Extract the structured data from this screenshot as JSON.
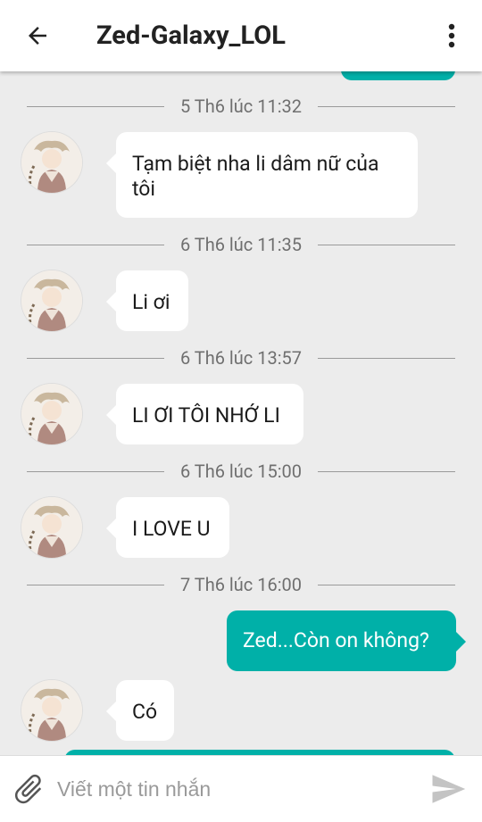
{
  "header": {
    "title": "Zed-Galaxy_LOL",
    "back_icon": "arrow-left-icon",
    "menu_icon": "more-vert-icon"
  },
  "colors": {
    "accent": "#00b0a8",
    "background": "#ececec",
    "bubble_in": "#ffffff"
  },
  "messages": [
    {
      "type": "divider",
      "text": "5 Th6 lúc 11:32"
    },
    {
      "type": "in",
      "text": "Tạm biệt nha li dâm nữ của tôi"
    },
    {
      "type": "divider",
      "text": "6 Th6 lúc 11:35"
    },
    {
      "type": "in",
      "text": "Li ơi"
    },
    {
      "type": "divider",
      "text": "6 Th6 lúc 13:57"
    },
    {
      "type": "in",
      "text": "LI ƠI TÔI NHỚ LI"
    },
    {
      "type": "divider",
      "text": "6 Th6 lúc 15:00"
    },
    {
      "type": "in",
      "text": "I LOVE U"
    },
    {
      "type": "divider",
      "text": "7 Th6 lúc 16:00"
    },
    {
      "type": "out",
      "text": "Zed...Còn on không?"
    },
    {
      "type": "in",
      "text": "Có"
    }
  ],
  "composer": {
    "placeholder": "Viết một tin nhắn",
    "value": "",
    "attach_icon": "paperclip-icon",
    "send_icon": "send-icon"
  }
}
